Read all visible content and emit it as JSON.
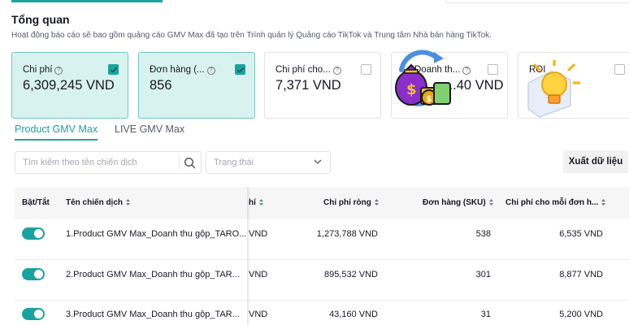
{
  "header": {
    "title": "Tổng quan",
    "subtitle": "Hoạt động báo cáo sẽ bao gồm quảng cáo GMV Max đã tạo trên Trình quản lý Quảng cáo TikTok và Trung tâm Nhà bán hàng TikTok."
  },
  "metrics": [
    {
      "label": "Chi phí",
      "value": "6,309,245 VND",
      "checked": true
    },
    {
      "label": "Đơn hàng (...",
      "value": "856",
      "checked": true
    },
    {
      "label": "Chi phí cho...",
      "value": "7,371 VND",
      "checked": false
    },
    {
      "label": "Doanh th...",
      "value": "...40 VND",
      "checked": false
    },
    {
      "label": "ROI",
      "value": "",
      "checked": false
    }
  ],
  "tabs": [
    {
      "label": "Product GMV Max",
      "active": true
    },
    {
      "label": "LIVE GMV Max",
      "active": false
    }
  ],
  "filters": {
    "search_placeholder": "Tìm kiếm theo tên chiến dịch",
    "status_placeholder": "Trạng thái",
    "export_label": "Xuất dữ liệu"
  },
  "table": {
    "columns": [
      "Bật/Tắt",
      "Tên chiến dịch",
      "hí",
      "Chi phí ròng",
      "Đơn hàng (SKU)",
      "Chi phí cho mỗi đơn h..."
    ],
    "rows": [
      {
        "enabled": true,
        "name": "1.Product GMV Max_Doanh thu gộp_TARO...",
        "cost": "VND",
        "net_cost": "1,273,788 VND",
        "orders": "538",
        "cost_per_order": "6,535 VND"
      },
      {
        "enabled": true,
        "name": "2.Product GMV Max_Doanh thu gộp_TAR...",
        "cost": "VND",
        "net_cost": "895,532 VND",
        "orders": "301",
        "cost_per_order": "8,877 VND"
      },
      {
        "enabled": true,
        "name": "3.Product GMV Max_Doanh thu gộp_TAR...",
        "cost": "VND",
        "net_cost": "43,160 VND",
        "orders": "31",
        "cost_per_order": "5,200 VND"
      }
    ]
  },
  "colors": {
    "accent": "#1aa39e",
    "selected_card": "#d8f2ef"
  }
}
